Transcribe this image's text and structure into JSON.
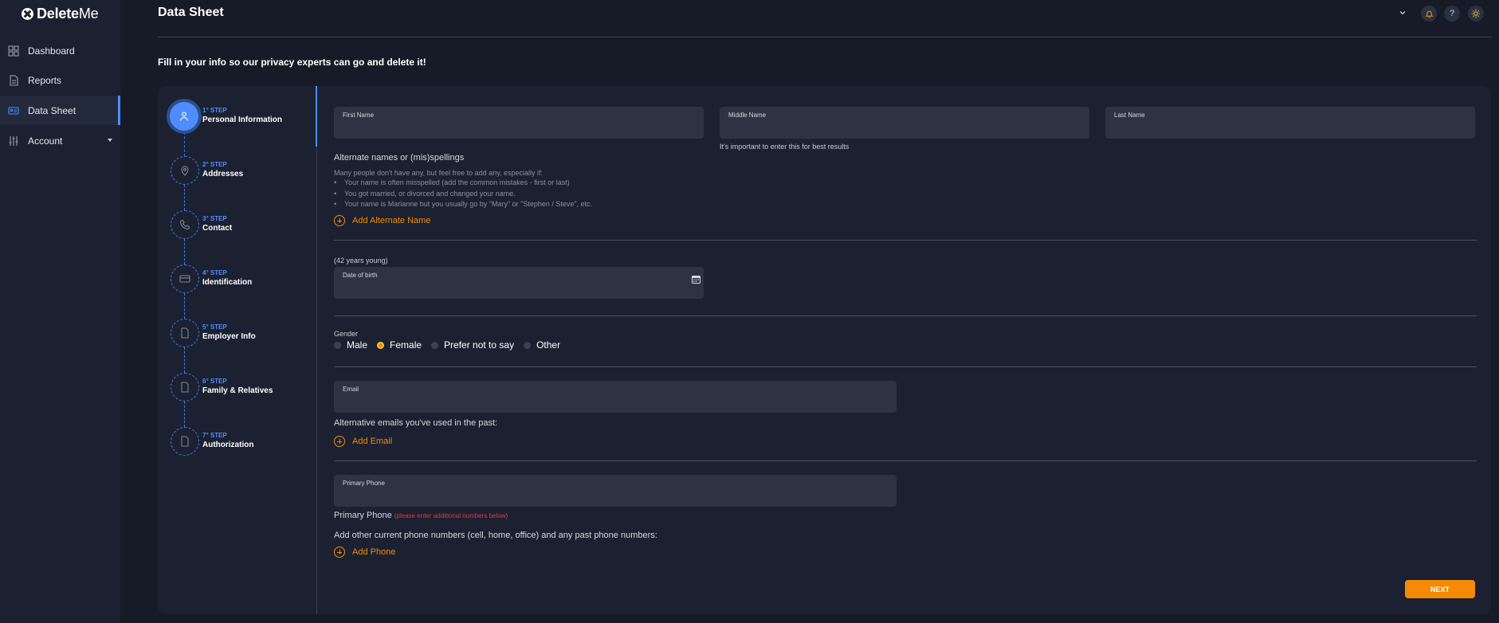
{
  "app": {
    "logo_bold": "Delete",
    "logo_light": "Me"
  },
  "sidebar": {
    "items": [
      {
        "label": "Dashboard",
        "icon": "grid-icon"
      },
      {
        "label": "Reports",
        "icon": "document-icon"
      },
      {
        "label": "Data Sheet",
        "icon": "id-card-icon",
        "active": true
      },
      {
        "label": "Account",
        "icon": "sliders-icon"
      }
    ]
  },
  "header": {
    "title": "Data Sheet",
    "icons": [
      "chevron-down-icon",
      "bell-icon",
      "help-icon",
      "sun-icon"
    ],
    "help_glyph": "?"
  },
  "intro": "Fill in your info so our privacy experts can go and delete it!",
  "steps": [
    {
      "num": "1° STEP",
      "name": "Personal Information",
      "icon": "user-icon",
      "active": true
    },
    {
      "num": "2° STEP",
      "name": "Addresses",
      "icon": "map-pin-icon"
    },
    {
      "num": "3° STEP",
      "name": "Contact",
      "icon": "phone-icon"
    },
    {
      "num": "4° STEP",
      "name": "Identification",
      "icon": "id-card-icon"
    },
    {
      "num": "5° STEP",
      "name": "Employer Info",
      "icon": "file-icon"
    },
    {
      "num": "6° STEP",
      "name": "Family & Relatives",
      "icon": "file-icon"
    },
    {
      "num": "7° STEP",
      "name": "Authorization",
      "icon": "file-icon"
    }
  ],
  "form": {
    "first_name": {
      "label": "First Name",
      "value": ""
    },
    "middle_name": {
      "label": "Middle Name",
      "value": "",
      "hint": "It's important to enter this for best results"
    },
    "last_name": {
      "label": "Last Name",
      "value": ""
    },
    "alt_names": {
      "title": "Alternate names or (mis)spellings",
      "intro": "Many people don't have any, but feel free to add any, especially if:",
      "bullets": [
        "Your name is often misspelled (add the common mistakes - first or last)",
        "You got married, or divorced and changed your name.",
        "Your name is Marianne but you usually go by \"Mary\" or \"Stephen / Steve\", etc."
      ],
      "add_label": "Add Alternate Name"
    },
    "dob": {
      "age_note": "(42 years young)",
      "label": "Date of birth",
      "value": ""
    },
    "gender": {
      "label": "Gender",
      "options": [
        "Male",
        "Female",
        "Prefer not to say",
        "Other"
      ],
      "selected": "Female"
    },
    "email": {
      "label": "Email",
      "value": "",
      "alt_title": "Alternative emails you've used in the past:",
      "add_label": "Add Email"
    },
    "phone": {
      "label": "Primary Phone",
      "value": "",
      "title": "Primary Phone",
      "note": "(please enter additional numbers below)",
      "others_title": "Add other current phone numbers (cell, home, office) and any past phone numbers:",
      "add_label": "Add Phone"
    },
    "next_label": "NEXT"
  },
  "colors": {
    "accent": "#f58a07",
    "primary": "#4f8cff",
    "background": "#161b27",
    "card": "#1b2130",
    "error": "#e53935"
  }
}
